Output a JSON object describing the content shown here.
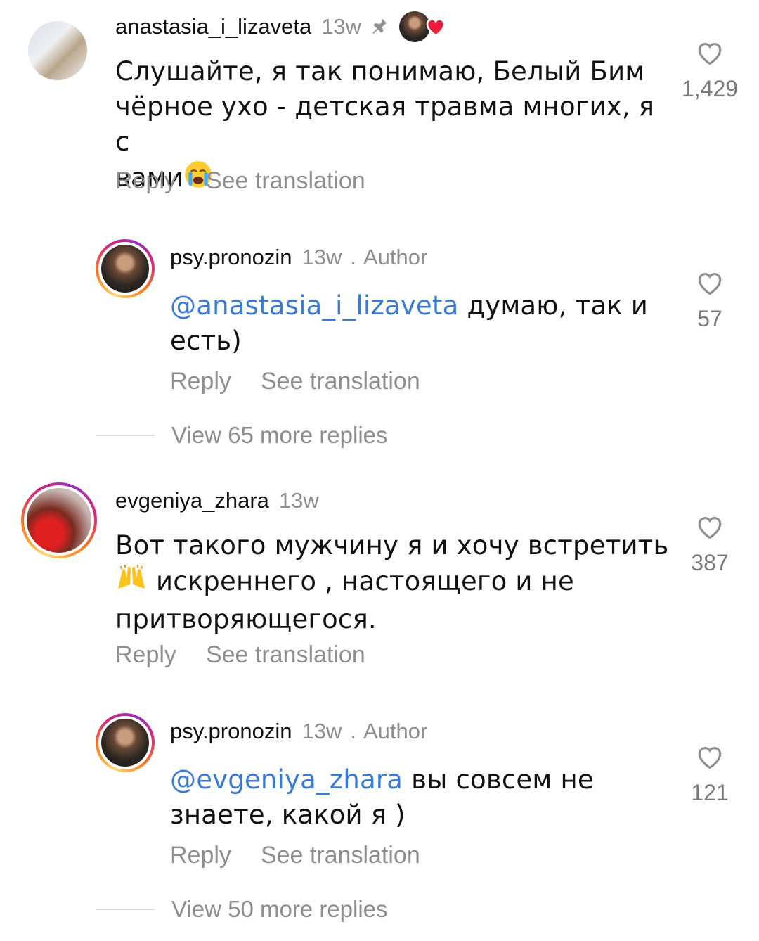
{
  "comments": [
    {
      "username": "anastasia_i_lizaveta",
      "time": "13w",
      "text": "Слушайте,  я так понимаю,  Белый Бим",
      "text_line2": "чёрное ухо - детская травма многих,  я с",
      "text_line3": "вами",
      "emoji": "loudly-crying-face",
      "likes": "1,429",
      "reply_label": "Reply",
      "translate_label": "See translation"
    },
    {
      "username": "psy.pronozin",
      "time": "13w",
      "author_label": "Author",
      "mention": "@anastasia_i_lizaveta",
      "text": "думаю, так и",
      "text_line2": "есть)",
      "likes": "57",
      "reply_label": "Reply",
      "translate_label": "See translation",
      "view_more": "View 65 more replies"
    },
    {
      "username": "evgeniya_zhara",
      "time": "13w",
      "text": "Вот такого мужчину я и хочу встретить",
      "emoji": "raising-hands",
      "text_line2": "искреннего , настоящего и не",
      "text_line3": "притворяющегося.",
      "likes": "387",
      "reply_label": "Reply",
      "translate_label": "See translation"
    },
    {
      "username": "psy.pronozin",
      "time": "13w",
      "author_label": "Author",
      "mention": "@evgeniya_zhara",
      "text": "вы совсем не",
      "text_line2": "знаете, какой я )",
      "likes": "121",
      "reply_label": "Reply",
      "translate_label": "See translation",
      "view_more": "View 50 more replies"
    }
  ],
  "colors": {
    "mention": "#3a7bd5",
    "muted": "#8e8e8e",
    "heart_red": "#ed1c3a"
  }
}
